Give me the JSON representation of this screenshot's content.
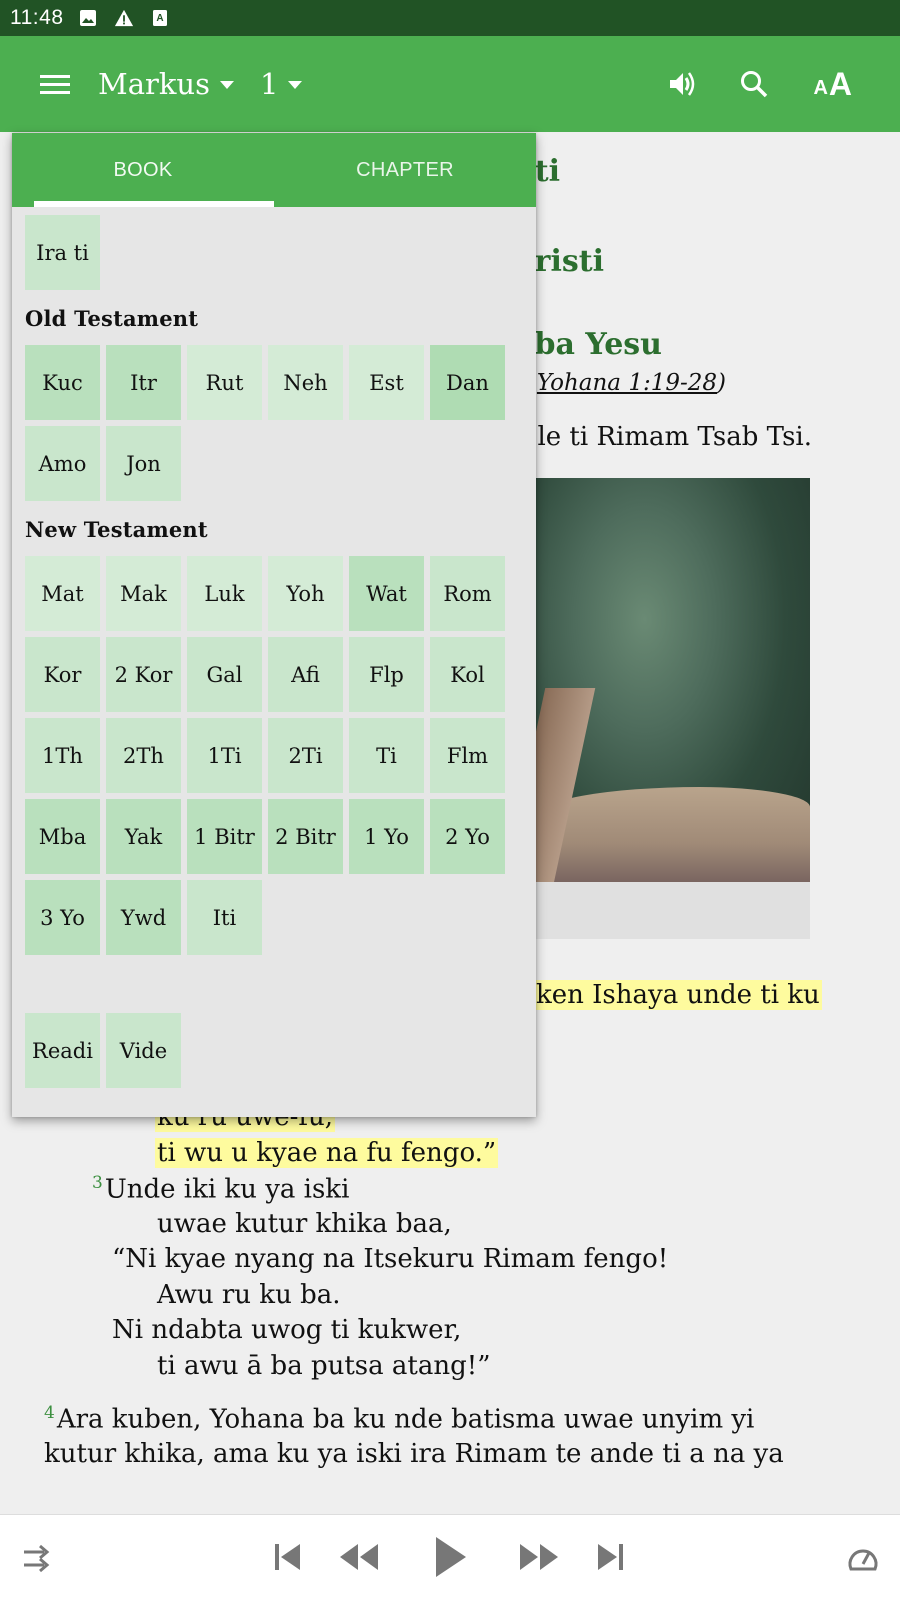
{
  "status_bar": {
    "time": "11:48",
    "icons": [
      "image-icon",
      "warning-icon",
      "text-notification-icon"
    ]
  },
  "toolbar": {
    "menu_icon": "hamburger-menu-icon",
    "book": "Markus",
    "chapter": "1",
    "actions": [
      "speaker-icon",
      "search-icon",
      "text-size-icon"
    ],
    "text_size_small": "A",
    "text_size_big": "A"
  },
  "colors": {
    "status_bar": "#215325",
    "primary": "#4caf50",
    "heading_green": "#2c6e2f",
    "highlight": "#fefb9e",
    "verse_number": "#3c8f40"
  },
  "book_picker": {
    "tabs": [
      {
        "label": "BOOK",
        "active": true
      },
      {
        "label": "CHAPTER",
        "active": false
      }
    ],
    "intro": [
      "Ira ti"
    ],
    "sections": [
      {
        "title": "Old Testament",
        "rows": [
          [
            "Kuc",
            "Itr",
            "Rut",
            "Neh",
            "Est",
            "Dan"
          ],
          [
            "Amo",
            "Jon"
          ]
        ]
      },
      {
        "title": "New Testament",
        "rows": [
          [
            "Mat",
            "Mak",
            "Luk",
            "Yoh",
            "Wat",
            "Rom"
          ],
          [
            "Kor",
            "2 Kor",
            "Gal",
            "Afi",
            "Flp",
            "Kol"
          ],
          [
            "1Th",
            "2Th",
            "1Ti",
            "2Ti",
            "Ti",
            "Flm"
          ],
          [
            "Mba",
            "Yak",
            "1 Bitr",
            "2 Bitr",
            "1 Yo",
            "2 Yo"
          ],
          [
            "3 Yo",
            "Ywd",
            "Iti"
          ]
        ]
      }
    ],
    "extras": [
      "Readi",
      "Vide"
    ]
  },
  "scripture": {
    "heading_1_fragment": "ti",
    "heading_2_fragment": "risti",
    "heading_3_fragment": "ba Yesu",
    "xref_fragment": "Yohana 1:19-28",
    "xref_close": ")",
    "line_fragment": "le ti Rimam Tsab Tsi.",
    "highlight_fragment": "ken Ishaya unde ti ku",
    "poetry": [
      {
        "text": "ku ru uwe-fu,",
        "highlight": true
      },
      {
        "text": "ti wu u kyae na fu fengo.”",
        "highlight": true
      }
    ],
    "verse3_number": "3",
    "verse3_lines": [
      "Unde iki ku ya iski",
      "uwae kutur khika baa,",
      "“Ni kyae nyang na Itsekuru Rimam fengo!",
      "Awu ru ku ba.",
      "Ni ndabta uwog ti kukwer,",
      "ti awu ā ba putsa atang!”"
    ],
    "verse4_number": "4",
    "verse4_lines": [
      "Ara kuben, Yohana ba ku nde batisma uwae unyim yi",
      "kutur khika, ama ku ya iski ira Rimam te ande ti a na ya"
    ]
  },
  "audio_bar": {
    "icons": [
      "repeat-icon",
      "skip-to-start-icon",
      "rewind-icon",
      "play-icon",
      "fast-forward-icon",
      "skip-to-end-icon",
      "speed-icon"
    ]
  }
}
